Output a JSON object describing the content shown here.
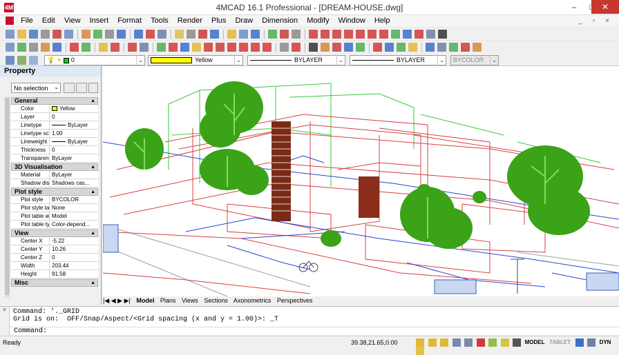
{
  "window": {
    "title": "4MCAD 16.1 Professional - [DREAM-HOUSE.dwg]",
    "minimize": "–",
    "maximize": "□",
    "close": "✕"
  },
  "menu": {
    "items": [
      "File",
      "Edit",
      "View",
      "Insert",
      "Format",
      "Tools",
      "Render",
      "Plus",
      "Draw",
      "Dimension",
      "Modify",
      "Window",
      "Help"
    ],
    "mdi_controls": "_ ▫ ×"
  },
  "properties_toolbar": {
    "layer": "0",
    "color": "Yellow",
    "linetype": "BYLAYER",
    "lineweight": "BYLAYER",
    "plotstyle": "BYCOLOR"
  },
  "panel": {
    "title": "Property",
    "selection": "No selection",
    "sections": [
      {
        "name": "General",
        "rows": [
          {
            "k": "Color",
            "v": "Yellow"
          },
          {
            "k": "Layer",
            "v": "0"
          },
          {
            "k": "Linetype",
            "v": "ByLayer"
          },
          {
            "k": "Linetype scale",
            "v": "1.00"
          },
          {
            "k": "Lineweight",
            "v": "ByLayer"
          },
          {
            "k": "Thickness",
            "v": "0"
          },
          {
            "k": "Transparency",
            "v": "ByLayer"
          }
        ]
      },
      {
        "name": "3D Visualisation",
        "rows": [
          {
            "k": "Material",
            "v": "ByLayer"
          },
          {
            "k": "Shadow displ...",
            "v": "Shadows cas..."
          }
        ]
      },
      {
        "name": "Plot style",
        "rows": [
          {
            "k": "Plot style",
            "v": "BYCOLOR"
          },
          {
            "k": "Plot style table",
            "v": "None"
          },
          {
            "k": "Plot table att...",
            "v": "Model"
          },
          {
            "k": "Plot table type",
            "v": "Color-depend..."
          }
        ]
      },
      {
        "name": "View",
        "rows": [
          {
            "k": "Center X",
            "v": "-5.22"
          },
          {
            "k": "Center Y",
            "v": "10.26"
          },
          {
            "k": "Center Z",
            "v": "0"
          },
          {
            "k": "Width",
            "v": "203.44"
          },
          {
            "k": "Height",
            "v": "91.58"
          }
        ]
      },
      {
        "name": "Misc",
        "rows": []
      }
    ]
  },
  "tabs": {
    "nav": "|◀ ◀ ▶ ▶|",
    "items": [
      "Model",
      "Plans",
      "Views",
      "Sections",
      "Axonometrics",
      "Perspectives"
    ]
  },
  "command": {
    "line1": "Command: '._GRID",
    "line2": "Grid is on:  OFF/Snap/Aspect/<Grid spacing (x and y = 1.00)>: _T",
    "prompt": "Command:"
  },
  "status": {
    "ready": "Ready",
    "coords": "39.38,21.65,0.00",
    "model": "MODEL",
    "tablet": "TABLET",
    "dyn": "DYN"
  },
  "colors": {
    "yellow": "#ffff00",
    "tree": "#3aa317",
    "red": "#d21d1d",
    "blue": "#1b3ccf",
    "green_line": "#22c322"
  }
}
